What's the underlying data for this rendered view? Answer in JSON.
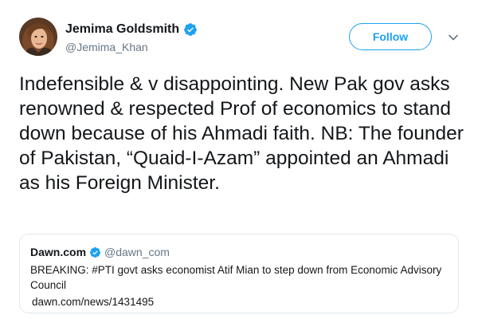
{
  "author": {
    "display_name": "Jemima Goldsmith",
    "handle": "@Jemima_Khan",
    "verified": true
  },
  "actions": {
    "follow_label": "Follow"
  },
  "tweet": {
    "text": "Indefensible & v disappointing. New Pak gov asks renowned & respected Prof of economics to stand down because of his Ahmadi faith. NB: The founder of Pakistan, “Quaid-I-Azam” appointed an Ahmadi as his Foreign Minister."
  },
  "quoted_tweet": {
    "display_name": "Dawn.com",
    "handle": "@dawn_com",
    "verified": true,
    "text": "BREAKING: #PTI govt asks economist Atif Mian to step down from Economic Advisory Council",
    "link": "dawn.com/news/1431495"
  },
  "colors": {
    "accent": "#1da1f2",
    "text": "#14171a",
    "secondary": "#657786",
    "border": "#e1e8ed"
  },
  "icons": {
    "verified": "verified-badge-icon",
    "menu": "chevron-down-icon",
    "avatar": "profile-photo"
  }
}
